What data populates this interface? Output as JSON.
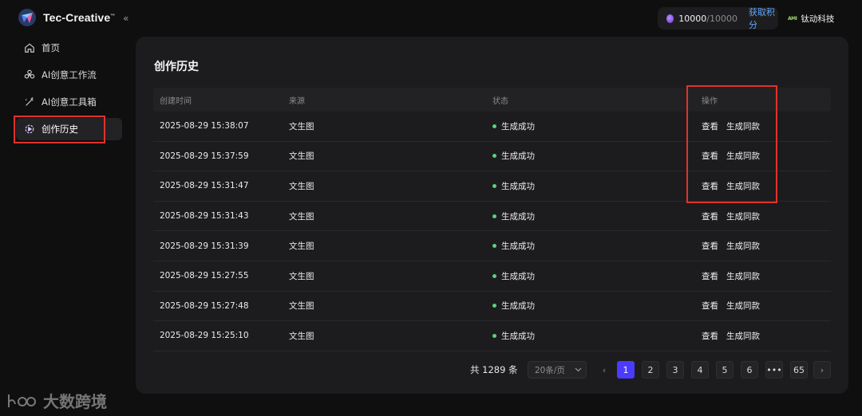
{
  "brand": {
    "name": "Tec-Creative",
    "tm": "™"
  },
  "collapse_icon": "«",
  "nav": [
    {
      "label": "首页",
      "icon": "home-icon"
    },
    {
      "label": "AI创意工作流",
      "icon": "workflow-icon"
    },
    {
      "label": "AI创意工具箱",
      "icon": "magic-wand-icon"
    },
    {
      "label": "创作历史",
      "icon": "history-icon",
      "active": true
    }
  ],
  "points": {
    "current": "10000",
    "max": "/10000",
    "action": "获取积分"
  },
  "company": {
    "mark": "AMI",
    "name": "钛动科技"
  },
  "page_title": "创作历史",
  "table": {
    "headers": [
      "创建时间",
      "来源",
      "状态",
      "操作"
    ],
    "rows": [
      {
        "time": "2025-08-29 15:38:07",
        "source": "文生图",
        "status": "生成成功",
        "view": "查看",
        "same": "生成同款"
      },
      {
        "time": "2025-08-29 15:37:59",
        "source": "文生图",
        "status": "生成成功",
        "view": "查看",
        "same": "生成同款"
      },
      {
        "time": "2025-08-29 15:31:47",
        "source": "文生图",
        "status": "生成成功",
        "view": "查看",
        "same": "生成同款"
      },
      {
        "time": "2025-08-29 15:31:43",
        "source": "文生图",
        "status": "生成成功",
        "view": "查看",
        "same": "生成同款"
      },
      {
        "time": "2025-08-29 15:31:39",
        "source": "文生图",
        "status": "生成成功",
        "view": "查看",
        "same": "生成同款"
      },
      {
        "time": "2025-08-29 15:27:55",
        "source": "文生图",
        "status": "生成成功",
        "view": "查看",
        "same": "生成同款"
      },
      {
        "time": "2025-08-29 15:27:48",
        "source": "文生图",
        "status": "生成成功",
        "view": "查看",
        "same": "生成同款"
      },
      {
        "time": "2025-08-29 15:25:10",
        "source": "文生图",
        "status": "生成成功",
        "view": "查看",
        "same": "生成同款"
      }
    ]
  },
  "pagination": {
    "total": "共 1289 条",
    "page_size": "20条/页",
    "prev": "‹",
    "next": "›",
    "pages": [
      "1",
      "2",
      "3",
      "4",
      "5",
      "6",
      "•••",
      "65"
    ],
    "current": "1"
  },
  "watermark": {
    "text": "大数跨境"
  },
  "colors": {
    "accent": "#4a3bff",
    "success": "#5bd17b",
    "link": "#5fa8ff",
    "highlight": "#e3312b"
  }
}
